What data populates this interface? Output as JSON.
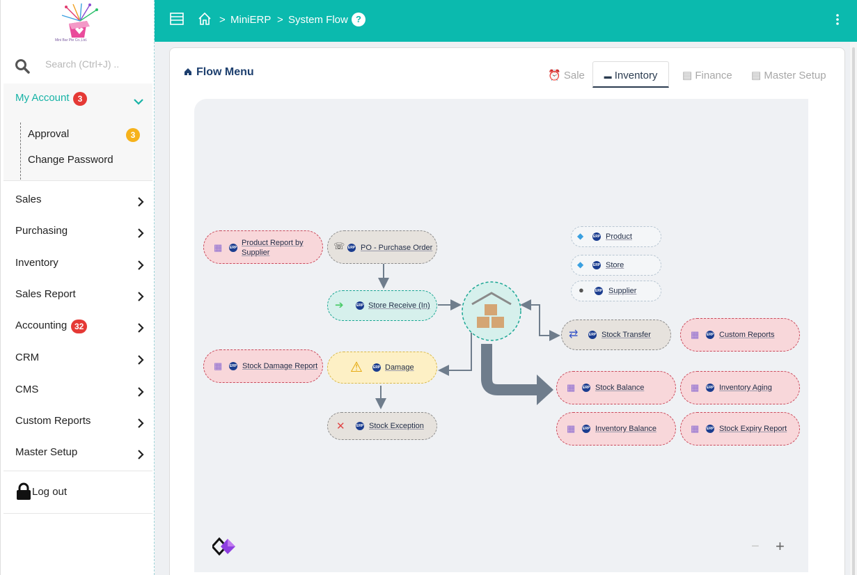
{
  "brand": {
    "logo_text": "Mini Bar Pte Co.,Ltd."
  },
  "search": {
    "placeholder": "Search (Ctrl+J) .."
  },
  "account": {
    "label": "My Account",
    "badge": "3",
    "items": [
      {
        "label": "Approval",
        "badge": "3"
      },
      {
        "label": "Change Password"
      }
    ]
  },
  "nav": [
    {
      "label": "Sales"
    },
    {
      "label": "Purchasing"
    },
    {
      "label": "Inventory"
    },
    {
      "label": "Sales Report"
    },
    {
      "label": "Accounting",
      "badge": "32"
    },
    {
      "label": "CRM"
    },
    {
      "label": "CMS"
    },
    {
      "label": "Custom Reports"
    },
    {
      "label": "Master Setup"
    }
  ],
  "logout": {
    "label": "Log out"
  },
  "breadcrumb": {
    "sep": ">",
    "app": "MiniERP",
    "page": "System Flow",
    "help": "?"
  },
  "flow": {
    "title": "Flow Menu",
    "tabs": [
      {
        "label": "Sale"
      },
      {
        "label": "Inventory",
        "active": true
      },
      {
        "label": "Finance"
      },
      {
        "label": "Master Setup"
      }
    ],
    "erp_badge": "ERP",
    "nodes": {
      "product_report_supplier": "Product Report by Supplier",
      "po": "PO - Purchase Order",
      "store_receive": "Store Receive (In)",
      "stock_damage_report": "Stock Damage Report",
      "damage": "Damage",
      "stock_exception": "Stock Exception",
      "product": "Product",
      "store": "Store",
      "supplier": "Supplier",
      "stock_transfer": "Stock Transfer",
      "custom_reports": "Custom Reports",
      "stock_balance": "Stock Balance",
      "inventory_aging": "Inventory Aging",
      "inventory_balance": "Inventory Balance",
      "stock_expiry_report": "Stock Expiry Report"
    },
    "zoom": {
      "minus": "−",
      "plus": "+"
    }
  },
  "colors": {
    "topbar": "#0bbaae",
    "accent": "#17b3a6",
    "badge_red": "#e53935",
    "badge_yellow": "#f6b21b"
  }
}
